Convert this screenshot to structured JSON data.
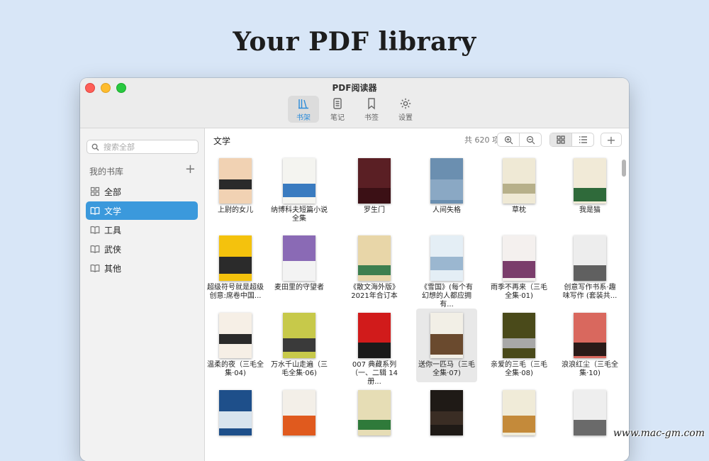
{
  "headline": "Your PDF library",
  "window": {
    "title": "PDF阅读器",
    "toolbar": [
      {
        "label": "书架",
        "icon": "bookshelf-icon",
        "active": true
      },
      {
        "label": "笔记",
        "icon": "notes-icon",
        "active": false
      },
      {
        "label": "书签",
        "icon": "bookmark-icon",
        "active": false
      },
      {
        "label": "设置",
        "icon": "gear-icon",
        "active": false
      }
    ]
  },
  "sidebar": {
    "search_placeholder": "搜索全部",
    "library_header": "我的书库",
    "add_label": "+",
    "items": [
      {
        "label": "全部",
        "icon": "grid-icon",
        "active": false
      },
      {
        "label": "文学",
        "icon": "book-icon",
        "active": true
      },
      {
        "label": "工具",
        "icon": "book-icon",
        "active": false
      },
      {
        "label": "武侠",
        "icon": "book-icon",
        "active": false
      },
      {
        "label": "其他",
        "icon": "book-icon",
        "active": false
      }
    ]
  },
  "content": {
    "category": "文学",
    "count": "共 620 项",
    "add_label": "+"
  },
  "books": [
    {
      "title": "上尉的女儿",
      "colors": [
        "#f1d2b3",
        "#2a2a2a"
      ]
    },
    {
      "title": "纳博科夫短篇小说全集",
      "colors": [
        "#f4f4f0",
        "#3a7bc0"
      ]
    },
    {
      "title": "罗生门",
      "colors": [
        "#5a1f24",
        "#3b1015"
      ]
    },
    {
      "title": "人间失格",
      "colors": [
        "#6b8fb0",
        "#8aa8c4"
      ]
    },
    {
      "title": "草枕",
      "colors": [
        "#efe9d5",
        "#b7b08a"
      ]
    },
    {
      "title": "我是猫",
      "colors": [
        "#f1ead7",
        "#2f6a3a"
      ]
    },
    {
      "title": "超级符号就是超级创意:席卷中国...",
      "colors": [
        "#f4c20d",
        "#2b2b2b"
      ]
    },
    {
      "title": "麦田里的守望者",
      "colors": [
        "#8a6ab5",
        "#f3f3f3"
      ]
    },
    {
      "title": "《散文海外版》2021年合订本",
      "colors": [
        "#e8d6a8",
        "#3d7f4f"
      ]
    },
    {
      "title": "《雪国》(每个有幻想的人都应拥有...",
      "colors": [
        "#e4eef5",
        "#9bb7d0"
      ]
    },
    {
      "title": "雨季不再来（三毛全集·01)",
      "colors": [
        "#f4f0ee",
        "#7a3d6b"
      ]
    },
    {
      "title": "创意写作书系·趣味写作 (套装共...",
      "colors": [
        "#ededed",
        "#606060"
      ]
    },
    {
      "title": "温柔的夜（三毛全集·04)",
      "colors": [
        "#f6efe6",
        "#2a2a2a"
      ]
    },
    {
      "title": "万水千山走遍（三毛全集·06)",
      "colors": [
        "#c7c94a",
        "#3a3a3a"
      ]
    },
    {
      "title": "007 典藏系列（一、二辑 14 册...",
      "colors": [
        "#d11b1b",
        "#1a1a1a"
      ]
    },
    {
      "title": "送你一匹马（三毛全集·07)",
      "colors": [
        "#f2efe6",
        "#6a4a2e"
      ]
    },
    {
      "title": "亲爱的三毛（三毛全集·08)",
      "colors": [
        "#4a4a1a",
        "#a8a8a8"
      ]
    },
    {
      "title": "浪浪红尘（三毛全集·10)",
      "colors": [
        "#d9685e",
        "#2a1a18"
      ]
    },
    {
      "title": "",
      "colors": [
        "#1e4f8a",
        "#d8e4ee"
      ]
    },
    {
      "title": "",
      "colors": [
        "#f3efe8",
        "#e05a1e"
      ]
    },
    {
      "title": "",
      "colors": [
        "#e6ddb5",
        "#2f7a3a"
      ]
    },
    {
      "title": "",
      "colors": [
        "#1f1a16",
        "#3a2d24"
      ]
    },
    {
      "title": "",
      "colors": [
        "#f0ebd8",
        "#c48a3a"
      ]
    },
    {
      "title": "",
      "colors": [
        "#eeeeee",
        "#6a6a6a"
      ]
    }
  ],
  "watermark": "www.mac-gm.com"
}
